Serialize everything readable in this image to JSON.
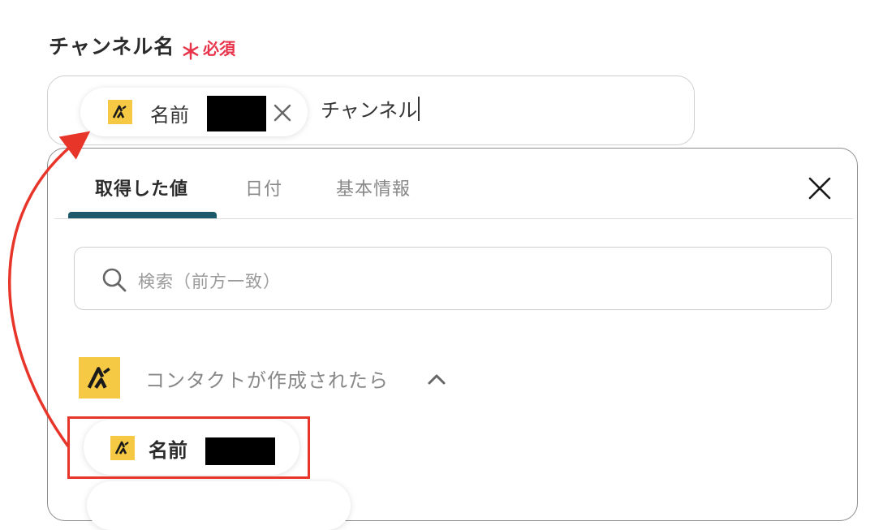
{
  "form": {
    "field_label": "チャンネル名",
    "required_star": "＊",
    "required_text": "必須",
    "input": {
      "chip_label": "名前",
      "typed_text": "チャンネル"
    }
  },
  "picker": {
    "tabs": [
      {
        "label": "取得した値",
        "active": true
      },
      {
        "label": "日付",
        "active": false
      },
      {
        "label": "基本情報",
        "active": false
      }
    ],
    "search_placeholder": "検索（前方一致）",
    "section": {
      "title": "コンタクトが作成されたら",
      "expanded": true,
      "items": [
        {
          "label": "名前"
        }
      ]
    }
  },
  "colors": {
    "required": "#e8334a",
    "tab_accent": "#1c5a6b",
    "logo_bg": "#f6c944",
    "annotation": "#e8352a"
  },
  "icons": {
    "app_logo": "app-logo-icon",
    "chip_remove": "close-icon",
    "panel_close": "close-icon",
    "search": "search-icon",
    "collapse": "chevron-up-icon"
  }
}
